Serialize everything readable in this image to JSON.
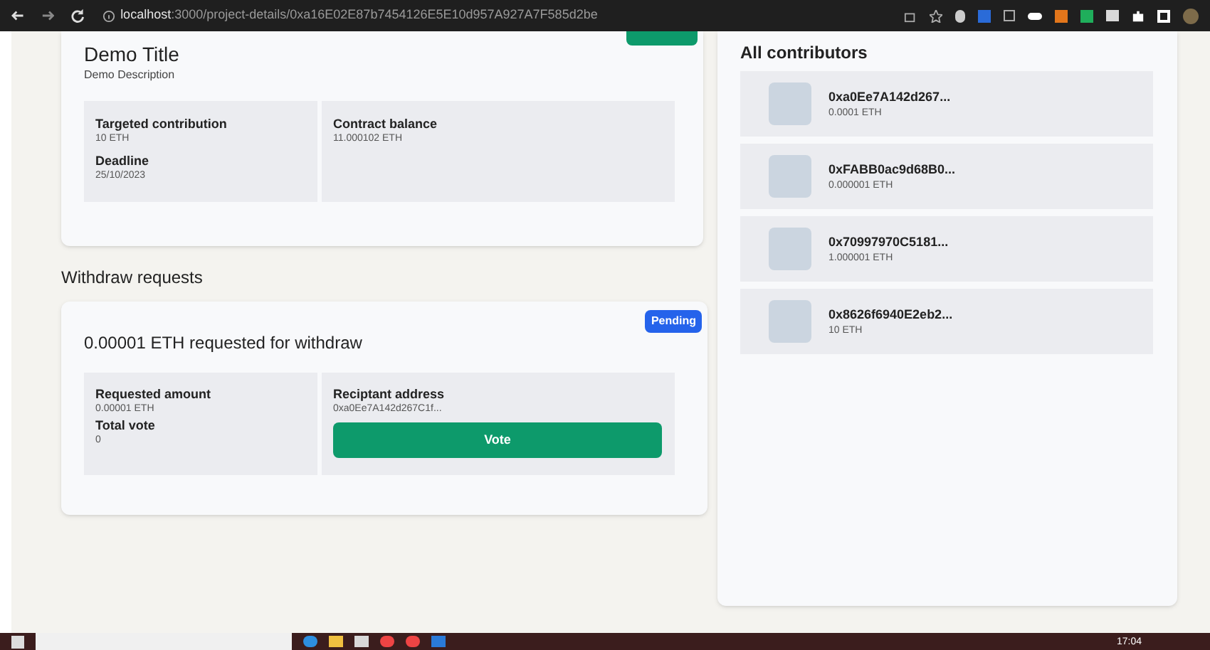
{
  "browser": {
    "url_host": "localhost",
    "url_path": ":3000/project-details/0xa16E02E87b7454126E5E10d957A927A7F585d2be"
  },
  "project": {
    "title": "Demo Title",
    "description": "Demo Description",
    "stats": [
      {
        "label": "Targeted contribution",
        "value": "10 ETH"
      },
      {
        "label": "Deadline",
        "value": "25/10/2023"
      },
      {
        "label": "Contract balance",
        "value": "11.000102 ETH"
      }
    ]
  },
  "withdraw_heading": "Withdraw requests",
  "requests": [
    {
      "title": "0.00001 ETH requested for withdraw",
      "status": "Pending",
      "amount_label": "Requested amount",
      "amount": "0.00001 ETH",
      "votes_label": "Total vote",
      "votes": "0",
      "recipient_label": "Reciptant address",
      "recipient": "0xa0Ee7A142d267C1f...",
      "button": "Vote"
    }
  ],
  "contributors_heading": "All contributors",
  "contributors": [
    {
      "address": "0xa0Ee7A142d267...",
      "amount": "0.0001 ETH"
    },
    {
      "address": "0xFABB0ac9d68B0...",
      "amount": "0.000001 ETH"
    },
    {
      "address": "0x70997970C5181...",
      "amount": "1.000001 ETH"
    },
    {
      "address": "0x8626f6940E2eb2...",
      "amount": "10 ETH"
    }
  ],
  "taskbar": {
    "clock": "17:04"
  }
}
